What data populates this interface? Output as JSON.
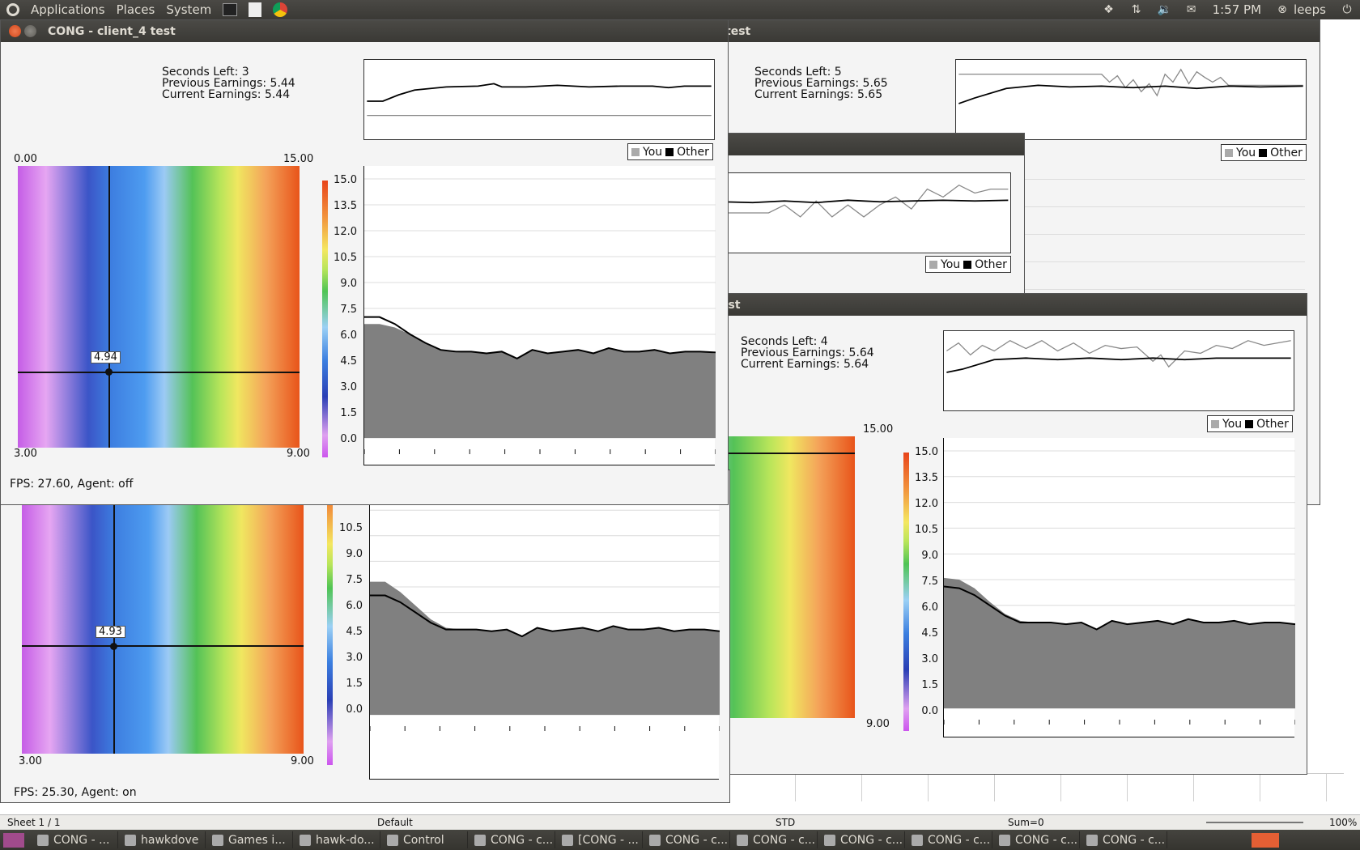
{
  "top_panel": {
    "menu": [
      "Applications",
      "Places",
      "System"
    ],
    "clock": "1:57 PM",
    "user": "leeps"
  },
  "windows": [
    {
      "title": "CONG - client_4 test",
      "seconds_left": "Seconds Left: 3",
      "previous_earnings": "Previous Earnings: 5.44",
      "current_earnings": "Current Earnings: 5.44",
      "legend_you": "You",
      "legend_other": "Other",
      "heat_top_left": "0.00",
      "heat_top_right": "15.00",
      "heat_bottom_left": "3.00",
      "heat_bottom_right": "9.00",
      "cursor_value": "4.94",
      "fps": "FPS: 27.60, Agent: off"
    },
    {
      "title": "test",
      "seconds_left": "Seconds Left: 5",
      "previous_earnings": "Previous Earnings: 5.65",
      "current_earnings": "Current Earnings: 5.65",
      "legend_you": "You",
      "legend_other": "Other"
    },
    {
      "legend_you": "You",
      "legend_other": "Other"
    },
    {
      "title": "est",
      "seconds_left": "Seconds Left: 4",
      "previous_earnings": "Previous Earnings: 5.64",
      "current_earnings": "Current Earnings: 5.64",
      "legend_you": "You",
      "legend_other": "Other",
      "heat_top_right": "15.00",
      "heat_bottom_right": "9.00"
    },
    {
      "heat_bottom_left": "3.00",
      "heat_bottom_right": "9.00",
      "cursor_value": "4.93",
      "fps": "FPS: 25.30, Agent: on"
    }
  ],
  "y_ticks": [
    "15.0",
    "13.5",
    "12.0",
    "10.5",
    "9.0",
    "7.5",
    "6.0",
    "4.5",
    "3.0",
    "1.5",
    "0.0"
  ],
  "y_ticks_partial": [
    "13.5",
    "12.0",
    "10.5",
    "9.0",
    "7.5",
    "6.0",
    "4.5",
    "3.0",
    "1.5",
    "0.0"
  ],
  "sheet_status": {
    "sheet": "Sheet 1 / 1",
    "style": "Default",
    "mode": "STD",
    "sum": "Sum=0",
    "zoom": "100%"
  },
  "taskbar": [
    "CONG - ...",
    "hawkdove",
    "Games i...",
    "hawk-do...",
    "Control",
    "CONG - c...",
    "[CONG - ...",
    "CONG - c...",
    "CONG - c...",
    "CONG - c...",
    "CONG - c...",
    "CONG - c...",
    "CONG - c..."
  ],
  "colors": {
    "you_fill": "#808080",
    "other_line": "#000000"
  },
  "chart_data": [
    {
      "type": "area",
      "title": "",
      "ylim": [
        0,
        15
      ],
      "series": [
        {
          "name": "You",
          "values": [
            6.6,
            6.6,
            6.4,
            6.0,
            5.5,
            5.1,
            4.95,
            5.0,
            4.9,
            5.0,
            4.6,
            5.1,
            4.9,
            5.0,
            5.1,
            4.9,
            5.2,
            5.0,
            5.0,
            5.1,
            4.9,
            5.0,
            5.0,
            4.9
          ]
        },
        {
          "name": "Other",
          "values": [
            7.0,
            7.0,
            6.6,
            6.0,
            5.5,
            5.1,
            5.0,
            5.0,
            4.9,
            5.0,
            4.6,
            5.1,
            4.9,
            5.0,
            5.1,
            4.9,
            5.2,
            5.0,
            5.0,
            5.1,
            4.9,
            5.0,
            5.0,
            4.95
          ]
        }
      ]
    },
    {
      "type": "area",
      "title": "",
      "ylim": [
        0,
        15
      ],
      "series": [
        {
          "name": "You",
          "values": [
            7.8,
            7.8,
            7.2,
            6.4,
            5.6,
            5.1,
            5.0,
            5.0,
            4.9,
            5.0,
            4.6,
            5.1,
            4.9,
            5.0,
            5.1,
            4.9,
            5.2,
            5.0,
            5.0,
            5.1,
            4.9,
            5.0,
            5.0,
            4.9
          ]
        },
        {
          "name": "Other",
          "values": [
            7.0,
            7.0,
            6.6,
            6.0,
            5.4,
            5.0,
            5.0,
            5.0,
            4.9,
            5.0,
            4.6,
            5.1,
            4.9,
            5.0,
            5.1,
            4.9,
            5.2,
            5.0,
            5.0,
            5.1,
            4.9,
            5.0,
            5.0,
            4.9
          ]
        }
      ]
    },
    {
      "type": "area",
      "title": "",
      "ylim": [
        0,
        15
      ],
      "series": [
        {
          "name": "You",
          "values": [
            7.6,
            7.5,
            7.0,
            6.2,
            5.5,
            5.1,
            5.0,
            5.0,
            4.9,
            5.0,
            4.6,
            5.1,
            4.9,
            5.0,
            5.1,
            4.9,
            5.2,
            5.0,
            5.0,
            5.1,
            4.9,
            5.0,
            5.0,
            4.9
          ]
        },
        {
          "name": "Other",
          "values": [
            7.1,
            7.0,
            6.6,
            6.0,
            5.4,
            5.0,
            5.0,
            5.0,
            4.9,
            5.0,
            4.6,
            5.1,
            4.9,
            5.0,
            5.1,
            4.9,
            5.2,
            5.0,
            5.0,
            5.1,
            4.9,
            5.0,
            5.0,
            4.9
          ]
        }
      ]
    }
  ]
}
